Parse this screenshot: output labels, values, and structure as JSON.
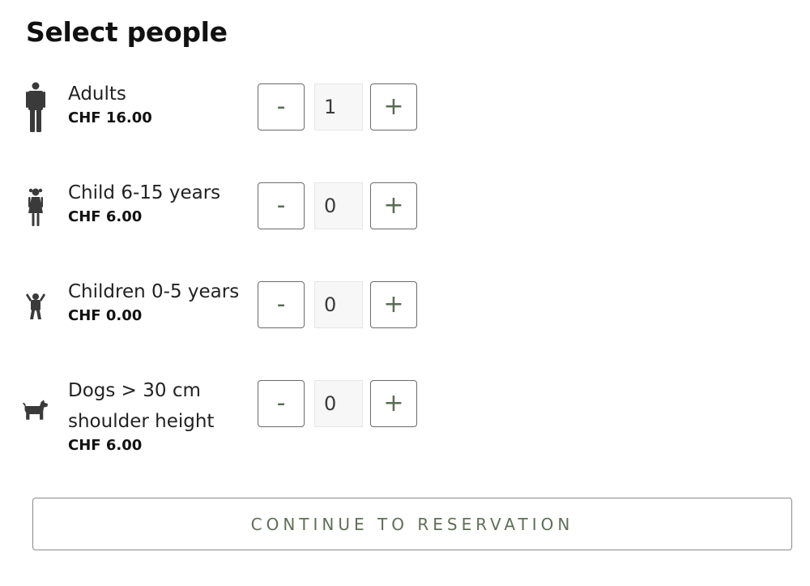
{
  "page": {
    "title": "Select people"
  },
  "categories": [
    {
      "name": "Adults",
      "price": "CHF 16.00",
      "quantity": "1",
      "icon": "adult-person-icon"
    },
    {
      "name": "Child 6-15 years",
      "price": "CHF 6.00",
      "quantity": "0",
      "icon": "child-girl-icon"
    },
    {
      "name": "Children 0-5 years",
      "price": "CHF 0.00",
      "quantity": "0",
      "icon": "toddler-icon"
    },
    {
      "name": "Dogs > 30 cm shoulder height",
      "price": "CHF 6.00",
      "quantity": "0",
      "icon": "dog-icon"
    }
  ],
  "stepper": {
    "minus_label": "-",
    "plus_label": "+"
  },
  "actions": {
    "continue_label": "CONTINUE TO RESERVATION"
  },
  "colors": {
    "accent": "#5f6f58",
    "icon": "#3a3a3a",
    "border": "#6b6b6b"
  }
}
